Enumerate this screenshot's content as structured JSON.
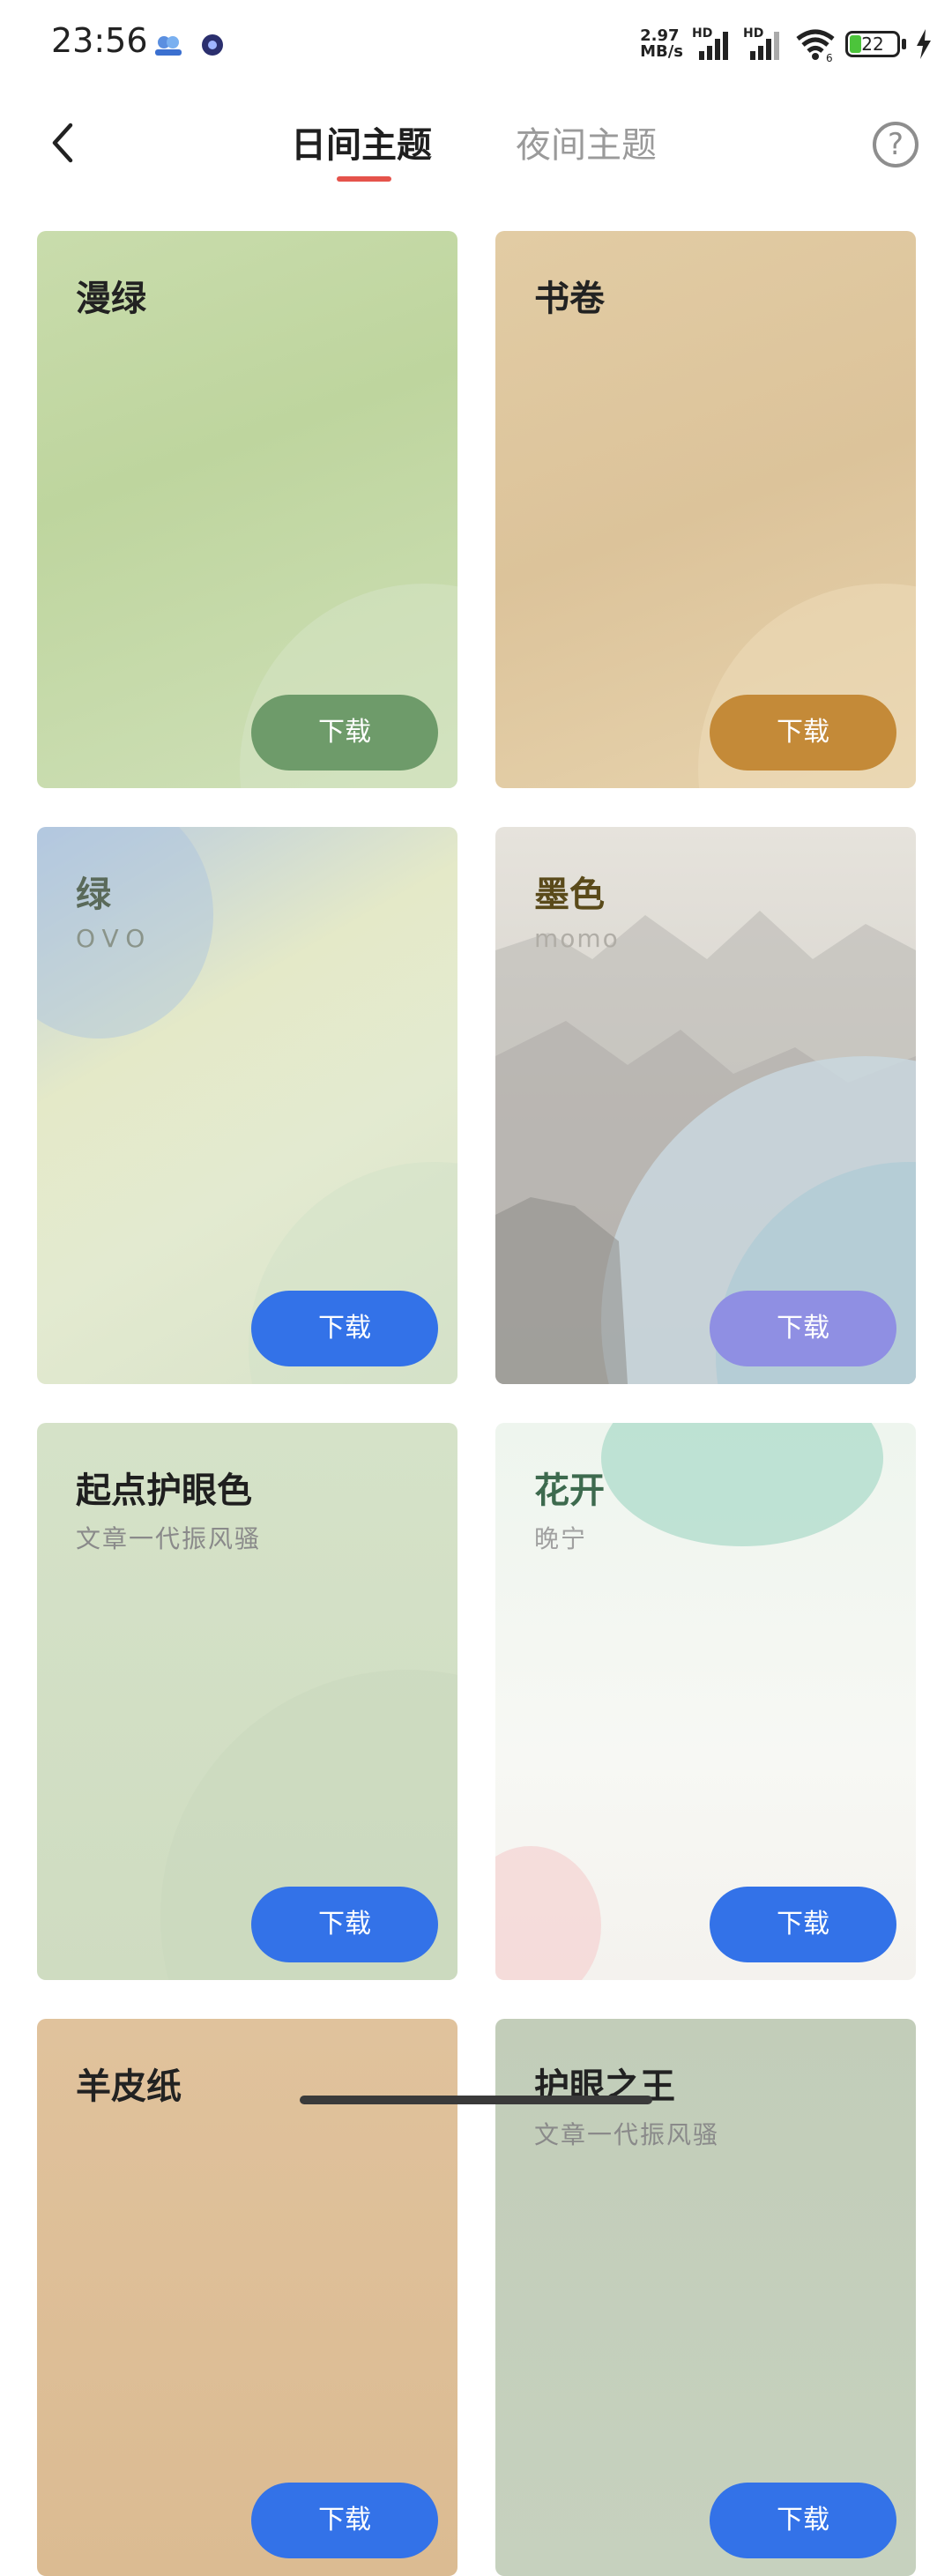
{
  "status_bar": {
    "time": "23:56",
    "net_speed_value": "2.97",
    "net_speed_unit": "MB/s",
    "signal_label_1": "HD",
    "signal_label_2": "HD",
    "wifi_badge": "6",
    "battery": "22"
  },
  "header": {
    "tab_day": "日间主题",
    "tab_night": "夜间主题",
    "help_symbol": "?"
  },
  "themes": [
    {
      "title": "漫绿",
      "subtitle": "",
      "button": "下载",
      "button_color": "#6e9b6a",
      "title_color": "#2a2a2a"
    },
    {
      "title": "书卷",
      "subtitle": "",
      "button": "下载",
      "button_color": "#c48a38",
      "title_color": "#2a2a2a"
    },
    {
      "title": "绿",
      "subtitle": "OVO",
      "button": "下载",
      "button_color": "#3372e8",
      "title_color": "#5a6a5a"
    },
    {
      "title": "墨色",
      "subtitle": "momo",
      "button": "下载",
      "button_color": "#8f8fe3",
      "title_color": "#5a4a1a"
    },
    {
      "title": "起点护眼色",
      "subtitle": "文章一代振风骚",
      "button": "下载",
      "button_color": "#3372e8",
      "title_color": "#1f1f1f"
    },
    {
      "title": "花开",
      "subtitle": "晚宁",
      "button": "下载",
      "button_color": "#3372e8",
      "title_color": "#3d6a4e"
    },
    {
      "title": "羊皮纸",
      "subtitle": "",
      "button": "下载",
      "button_color": "#3372e8",
      "title_color": "#1f1f1f"
    },
    {
      "title": "护眼之王",
      "subtitle": "文章一代振风骚",
      "button": "下载",
      "button_color": "#3372e8",
      "title_color": "#1f1f1f"
    }
  ]
}
